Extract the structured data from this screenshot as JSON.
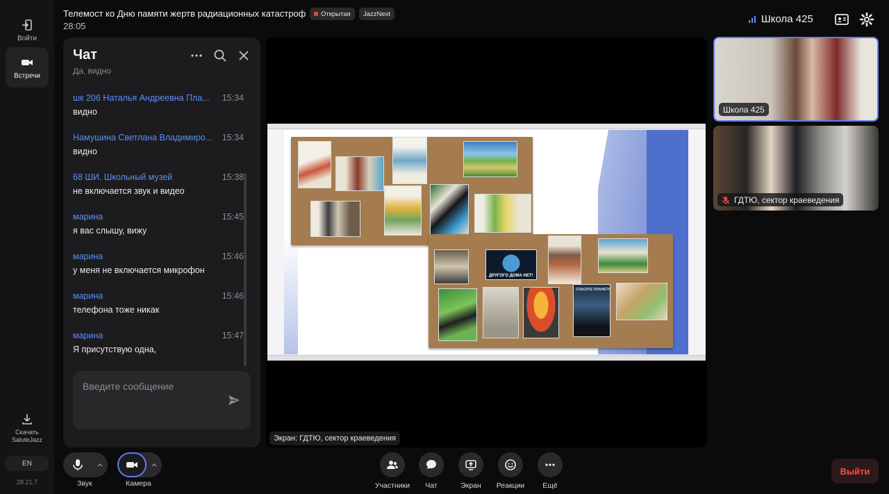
{
  "rail": {
    "login_label": "Войти",
    "meetings_label": "Встречи",
    "download_label_1": "Скачать",
    "download_label_2": "SaluteJazz",
    "lang": "EN",
    "version": "28.21.7"
  },
  "header": {
    "title": "Телемост ко Дню памяти жертв радиационных катастроф",
    "badge_open": "Открытая",
    "badge_app": "JazzNext",
    "timer": "28:05",
    "room_name": "Школа 425"
  },
  "chat": {
    "title": "Чат",
    "cutoff_text": "Да, видно",
    "messages": [
      {
        "author": "шк 206 Наталья Андреевна Пла...",
        "time": "15:34",
        "text": "видно"
      },
      {
        "author": "Намушина Светлана Владимиро...",
        "time": "15:34",
        "text": "видно"
      },
      {
        "author": "68 ШИ. Школьный музей",
        "time": "15:38",
        "text": "не включается звук и видео"
      },
      {
        "author": "марина",
        "time": "15:45",
        "text": "я вас слышу, вижу"
      },
      {
        "author": "марина",
        "time": "15:46",
        "text": "у меня не включается микрофон"
      },
      {
        "author": "марина",
        "time": "15:46",
        "text": "телефона тоже никак"
      },
      {
        "author": "марина",
        "time": "15:47",
        "text": "Я присутствую одна,"
      }
    ],
    "input_placeholder": "Введите сообщение"
  },
  "stage": {
    "screen_caption": "Экран: ГДТЮ, сектор краеведения",
    "poster_text": "ДРУГОГО ДОМА НЕТ!",
    "poster_text_2": "СПАСИТЕ ПЛАНЕТУ"
  },
  "participants": [
    {
      "name": "Школа 425"
    },
    {
      "name": "ГДТЮ, сектор краеведения"
    }
  ],
  "controls": {
    "sound": "Звук",
    "camera": "Камера",
    "participants": "Участники",
    "chat": "Чат",
    "screen": "Экран",
    "reactions": "Реакции",
    "more": "Ещё",
    "leave": "Выйти"
  },
  "colors": {
    "accent": "#5d7cf6",
    "author": "#5b8df5",
    "leave": "#ff4a4a"
  }
}
